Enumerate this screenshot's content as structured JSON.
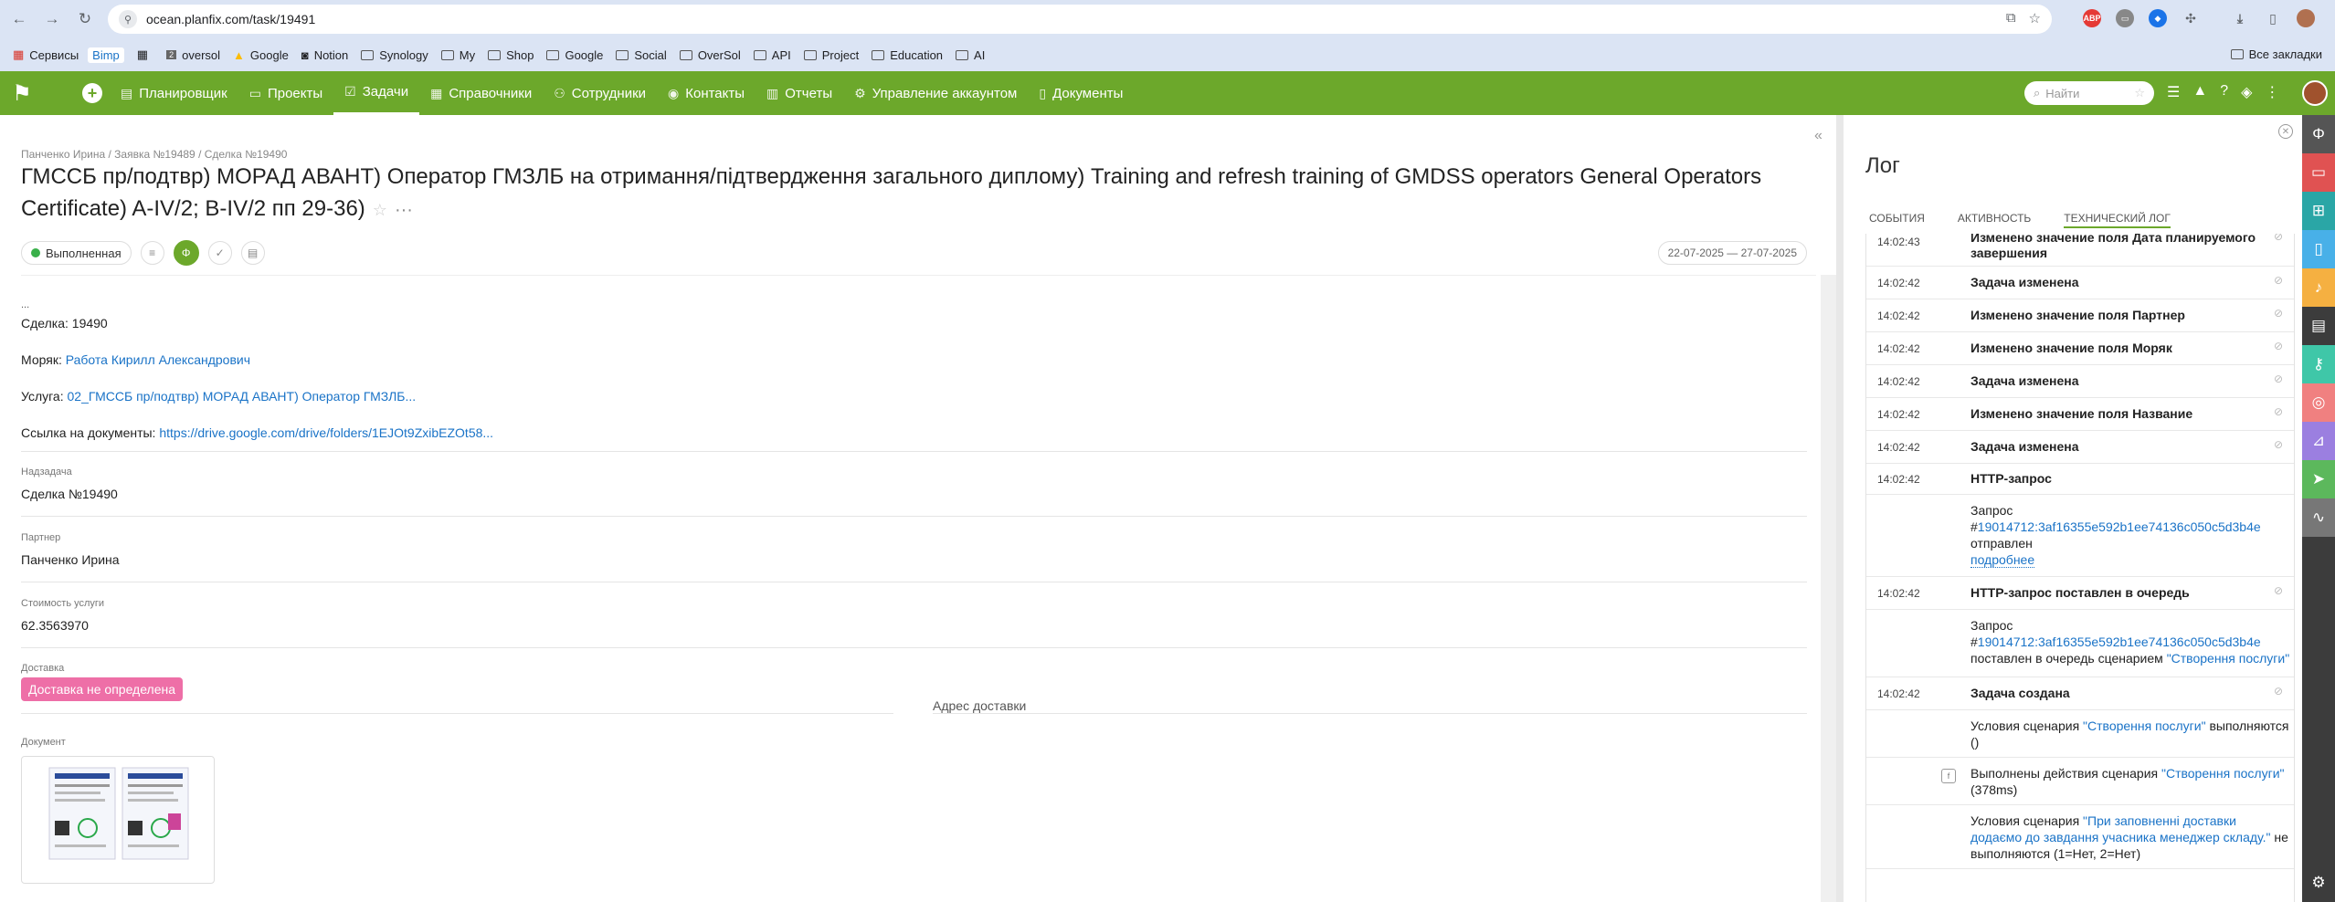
{
  "browser": {
    "url": "ocean.planfix.com/task/19491",
    "bookmarks": [
      "Сервисы",
      "Bimp",
      "oversol",
      "Google",
      "Notion",
      "Synology",
      "My",
      "Shop",
      "Google",
      "Social",
      "OverSol",
      "API",
      "Project",
      "Education",
      "AI"
    ],
    "all_bookmarks": "Все закладки",
    "ext_abp": "ABP"
  },
  "nav": {
    "items": [
      "Планировщик",
      "Проекты",
      "Задачи",
      "Справочники",
      "Сотрудники",
      "Контакты",
      "Отчеты",
      "Управление аккаунтом",
      "Документы"
    ],
    "search_placeholder": "Найти"
  },
  "task": {
    "breadcrumb": "Панченко Ирина / Заявка №19489 / Сделка №19490",
    "title": "ГМССБ пр/подтвр) МОРАД АВАНТ) Оператор ГМЗЛБ на отримання/підтвердження загального диплому) Training and refresh training of GMDSS operators General Operators Certificate) A-IV/2; B-IV/2 пп 29-36)",
    "status": "Выполненная",
    "dates": "22-07-2025 — 27-07-2025",
    "dots": "...",
    "deal_label": "Сделка:",
    "deal_value": "19490",
    "sailor_label": "Моряк:",
    "sailor_value": "Работа Кирилл Александрович",
    "service_label": "Услуга:",
    "service_value": "02_ГМССБ пр/подтвр) МОРАД АВАНТ) Оператор ГМЗЛБ...",
    "docs_label": "Ссылка на документы:",
    "docs_value": "https://drive.google.com/drive/folders/1EJOt9ZxibEZOt58...",
    "parent_label": "Надзадача",
    "parent_value": "Сделка №19490",
    "partner_label": "Партнер",
    "partner_value": "Панченко Ирина",
    "cost_label": "Стоимость услуги",
    "cost_value": "62.3563970",
    "delivery_label": "Доставка",
    "delivery_value": "Доставка не определена",
    "address_label": "Адрес доставки",
    "document_label": "Документ"
  },
  "log": {
    "title": "Лог",
    "tabs": [
      "События",
      "Активность",
      "Технический лог"
    ],
    "rows": [
      {
        "time": "14:02:43",
        "event": "Изменено значение поля Дата планируемого завершения"
      },
      {
        "time": "14:02:42",
        "event": "Задача изменена"
      },
      {
        "time": "14:02:42",
        "event": "Изменено значение поля Партнер"
      },
      {
        "time": "14:02:42",
        "event": "Изменено значение поля Моряк"
      },
      {
        "time": "14:02:42",
        "event": "Задача изменена"
      },
      {
        "time": "14:02:42",
        "event": "Изменено значение поля Название"
      },
      {
        "time": "14:02:42",
        "event": "Задача изменена"
      },
      {
        "time": "14:02:42",
        "event": "HTTP-запрос"
      },
      {
        "time": "14:02:42",
        "event": "HTTP-запрос поставлен в очередь"
      },
      {
        "time": "14:02:42",
        "event": "Задача создана"
      }
    ],
    "http_detail": {
      "prefix": "Запрос #",
      "id": "19014712:3af16355e592b1ee74136c050c5d3b4e",
      "sent": "отправлен",
      "more": "подробнее"
    },
    "queue_detail": {
      "prefix": "Запрос #",
      "id": "19014712:3af16355e592b1ee74136c050c5d3b4e",
      "text": "поставлен в очередь сценарием",
      "scenario": "\"Створення послуги\""
    },
    "cond1": {
      "a": "Условия сценария",
      "b": "\"Створення послуги\"",
      "c": "выполняются ()"
    },
    "act1": {
      "a": "Выполнены действия сценария",
      "b": "\"Створення послуги\"",
      "c": "(378ms)"
    },
    "cond2": {
      "a": "Условия сценария",
      "b": "\"При заповненні доставки додаємо до завдання учасника менеджер складу.\"",
      "c": "не выполняются (1=Нет, 2=Нет)"
    }
  }
}
